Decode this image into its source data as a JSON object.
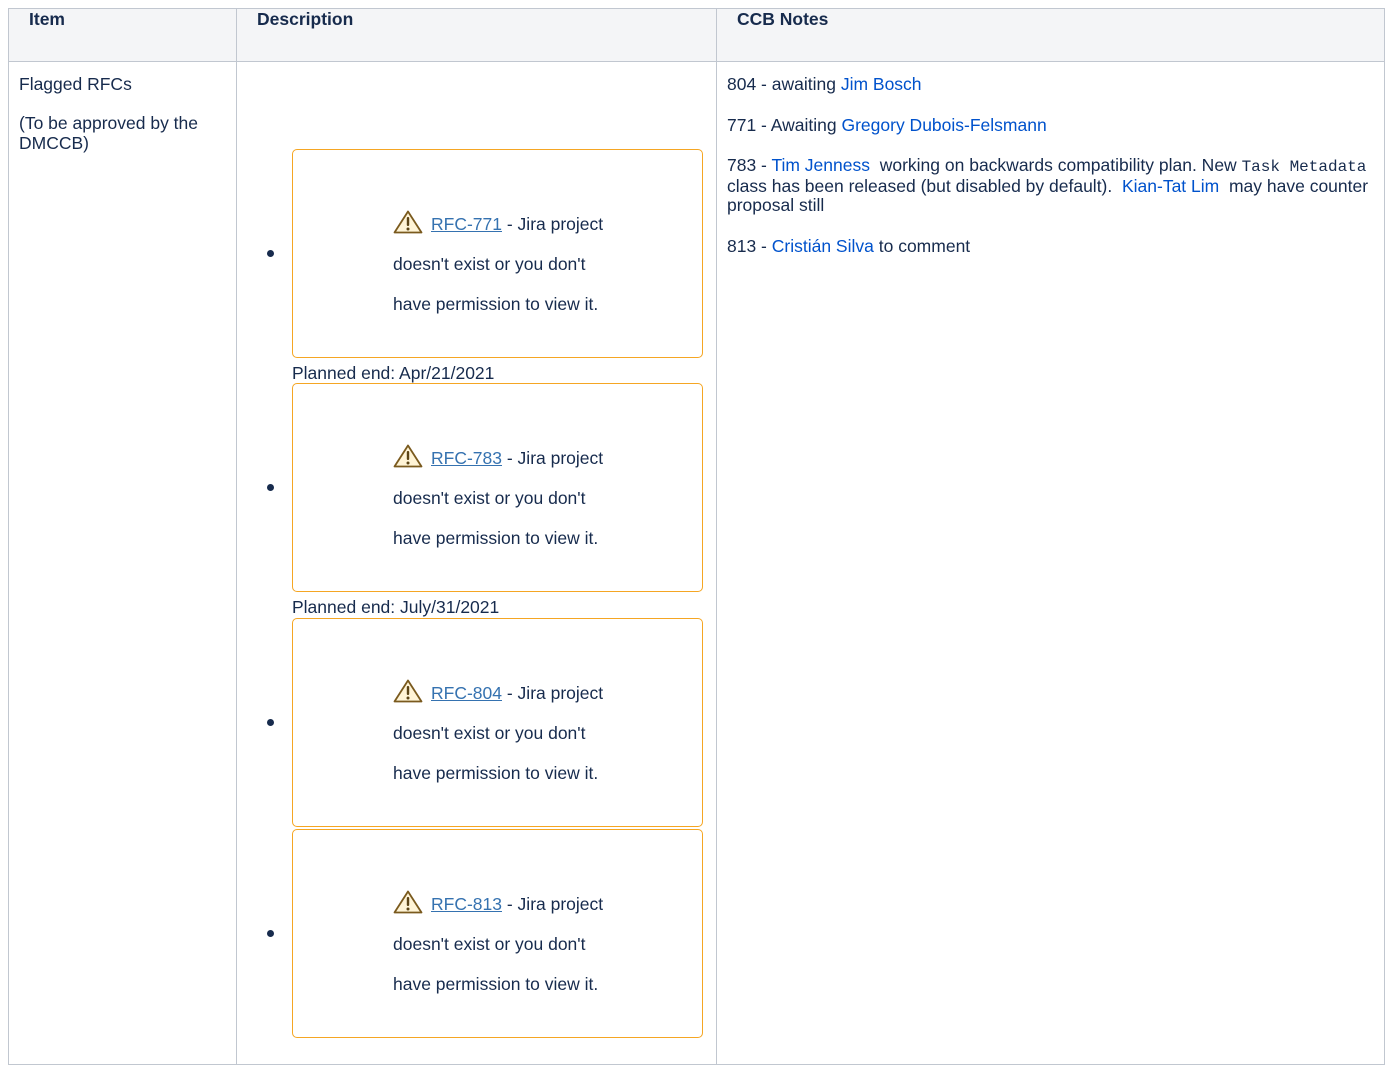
{
  "table": {
    "headers": [
      "Item",
      "Description",
      "CCB Notes"
    ],
    "item": {
      "title": "Flagged RFCs",
      "subtitle": "(To be approved by the DMCCB)"
    },
    "rfcs": [
      {
        "key": "RFC-771",
        "message_1": " - Jira project",
        "message_2": "doesn't exist or you don't",
        "message_3": "have permission to view it.",
        "planned_end": "Planned end: Apr/21/2021"
      },
      {
        "key": "RFC-783",
        "message_1": " - Jira project",
        "message_2": "doesn't exist or you don't",
        "message_3": "have permission to view it.",
        "planned_end": "Planned end: July/31/2021"
      },
      {
        "key": "RFC-804",
        "message_1": " - Jira project",
        "message_2": "doesn't exist or you don't",
        "message_3": "have permission to view it.",
        "planned_end": ""
      },
      {
        "key": "RFC-813",
        "message_1": " - Jira project",
        "message_2": "doesn't exist or you don't",
        "message_3": "have permission to view it.",
        "planned_end": ""
      }
    ],
    "notes": {
      "n804": {
        "prefix": "804 - awaiting ",
        "person": "Jim Bosch"
      },
      "n771": {
        "prefix": "771 - Awaiting ",
        "person": "Gregory Dubois-Felsmann"
      },
      "n783": {
        "prefix": "783 - ",
        "person1": "Tim Jenness",
        "text1": "  working on backwards compatibility plan. New ",
        "code": "Task Metadata",
        "text2": "  class has been released (but disabled by default).  ",
        "person2": "Kian-Tat Lim",
        "text3": "  may have counter proposal still"
      },
      "n813": {
        "prefix": "813 - ",
        "person": "Cristián Silva",
        "suffix": " to comment"
      }
    }
  },
  "icons": {
    "warning": "warning-triangle-icon"
  },
  "colors": {
    "box_border": "#f5a623",
    "link": "#0052cc",
    "rfc_link": "#3572b0",
    "header_bg": "#f4f5f7"
  }
}
